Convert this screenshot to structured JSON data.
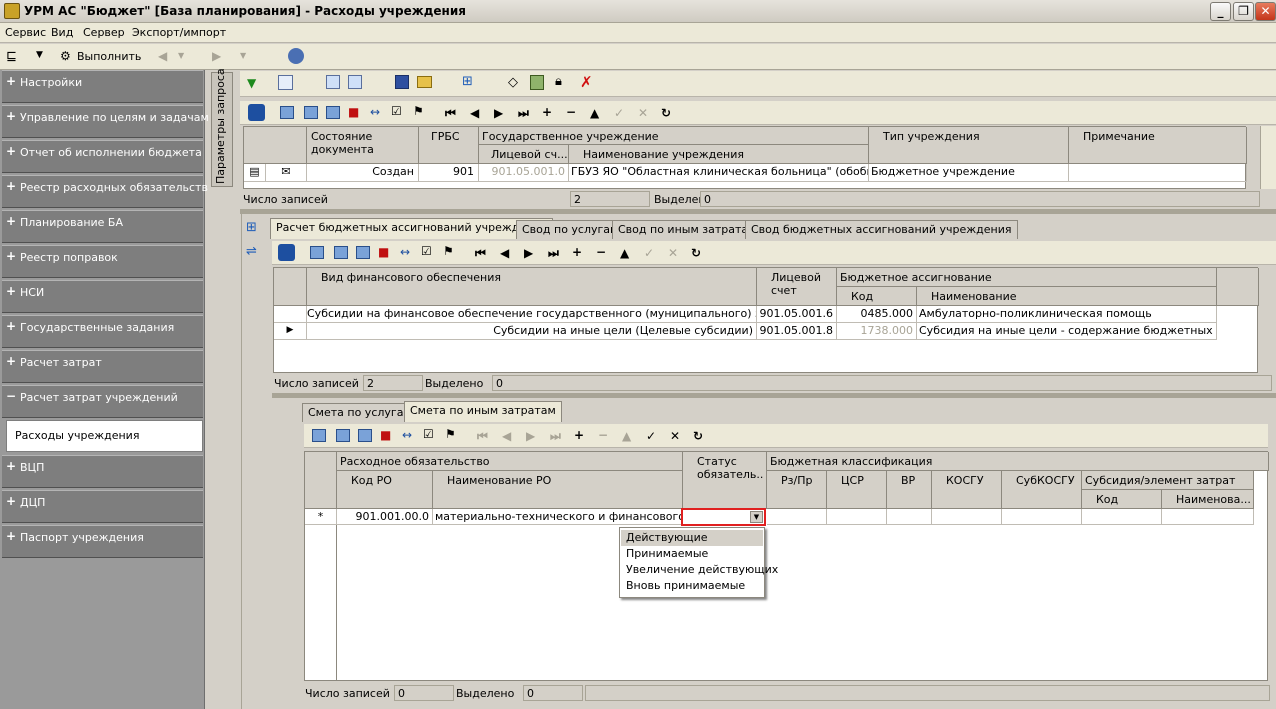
{
  "window": {
    "title": "УРМ АС \"Бюджет\" [База планирования] - Расходы учреждения",
    "buttons": [
      "_",
      "❐",
      "✕"
    ]
  },
  "menu": [
    "Сервис",
    "Вид",
    "Сервер",
    "Экспорт/импорт"
  ],
  "toolbar": {
    "execute": "Выполнить"
  },
  "sidebar": {
    "items": [
      {
        "label": "Настройки",
        "sign": "+"
      },
      {
        "label": "Управление по целям и задачам",
        "sign": "+"
      },
      {
        "label": "Отчет об исполнении бюджета",
        "sign": "+"
      },
      {
        "label": "Реестр расходных обязательств",
        "sign": "+"
      },
      {
        "label": "Планирование БА",
        "sign": "+"
      },
      {
        "label": "Реестр поправок",
        "sign": "+"
      },
      {
        "label": "НСИ",
        "sign": "+"
      },
      {
        "label": "Государственные задания",
        "sign": "+"
      },
      {
        "label": "Расчет затрат",
        "sign": "+"
      },
      {
        "label": "Расчет затрат учреждений",
        "sign": "−"
      },
      {
        "label": "ВЦП",
        "sign": "+"
      },
      {
        "label": "ДЦП",
        "sign": "+"
      },
      {
        "label": "Паспорт учреждения",
        "sign": "+"
      }
    ],
    "selected": "Расходы учреждения"
  },
  "vertical_tab": "Параметры запроса",
  "grid1": {
    "headers": {
      "state": "Состояние документа",
      "grbs": "ГРБС",
      "institution": "Государственное учреждение",
      "account": "Лицевой сч...",
      "inst_name": "Наименование учреждения",
      "type": "Тип учреждения",
      "note": "Примечание"
    },
    "row": {
      "state": "Создан",
      "grbs": "901",
      "account": "901.05.001.0",
      "inst_name": "ГБУЗ ЯО \"Областная клиническая больница\" (обобщенн",
      "type": "Бюджетное учреждение",
      "note": ""
    },
    "status": {
      "count_label": "Число записей",
      "count": "2",
      "selected_label": "Выделено",
      "selected": "0"
    }
  },
  "tabs1": [
    "Расчет бюджетных ассигнований учреждения",
    "Свод по услугам",
    "Свод по иным затратам",
    "Свод бюджетных ассигнований учреждения"
  ],
  "grid2": {
    "headers": {
      "fin": "Вид финансового обеспечения",
      "account": "Лицевой счет",
      "ba": "Бюджетное ассигнование",
      "code": "Код",
      "name": "Наименование"
    },
    "rows": [
      {
        "fin": "Субсидии на финансовое обеспечение государственного (муниципального) задания",
        "account": "901.05.001.6",
        "code": "0485.000",
        "name": "Амбулаторно-поликлиническая помощь"
      },
      {
        "fin": "Субсидии на иные цели (Целевые субсидии)",
        "account": "901.05.001.8",
        "code": "1738.000",
        "name": "Субсидия на иные цели - содержание бюджетных учрежде"
      }
    ],
    "status": {
      "count_label": "Число записей",
      "count": "2",
      "selected_label": "Выделено",
      "selected": "0"
    }
  },
  "tabs2": [
    "Смета по услугам",
    "Смета по иным затратам"
  ],
  "grid3": {
    "headers": {
      "ro": "Расходное обязательство",
      "code_ro": "Код РО",
      "name_ro": "Наименование РО",
      "status": "Статус обязатель..",
      "bk": "Бюджетная классификация",
      "rzpr": "Рз/Пр",
      "csr": "ЦСР",
      "vr": "ВР",
      "kosgu": "КОСГУ",
      "subkosgu": "СубКОСГУ",
      "subsidy": "Субсидия/элемент затрат",
      "code": "Код",
      "name": "Наименова..."
    },
    "row": {
      "marker": "*",
      "code_ro": "901.001.00.0",
      "name_ro": "материально-технического и финансового обеспе"
    },
    "dropdown": [
      "Действующие",
      "Принимаемые",
      "Увеличение действующих",
      "Вновь принимаемые"
    ],
    "status": {
      "count_label": "Число записей",
      "count": "0",
      "selected_label": "Выделено",
      "selected": "0"
    }
  }
}
